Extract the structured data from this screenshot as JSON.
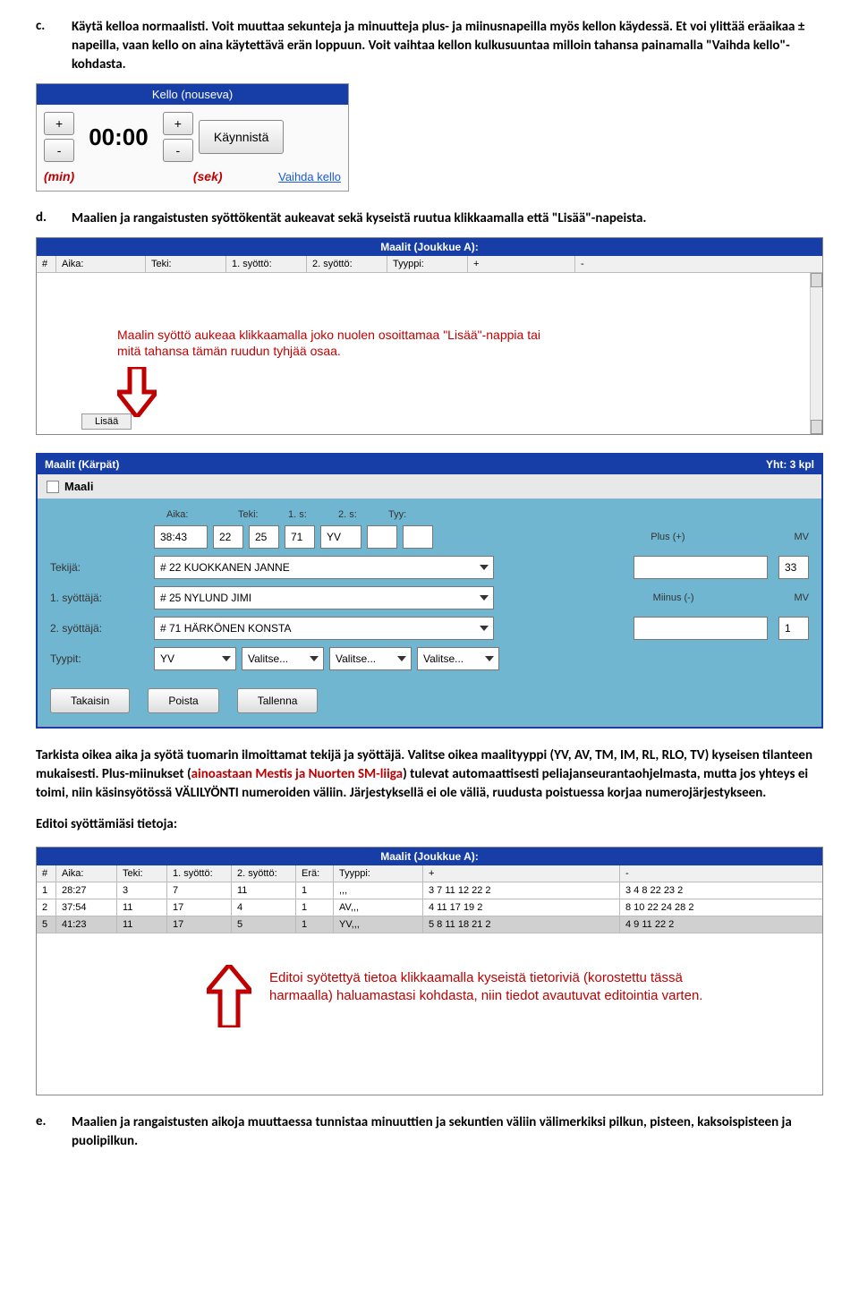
{
  "item_c": {
    "marker": "c.",
    "text_bold": "Käytä kelloa normaalisti. Voit muuttaa sekunteja ja minuutteja plus- ja miinusnapeilla myös kellon käydessä. Et voi ylittää eräaikaa ± napeilla, vaan kello on aina käytettävä erän loppuun. Voit vaihtaa kellon kulkusuuntaa milloin tahansa painamalla \"Vaihda kello\"-kohdasta."
  },
  "kello": {
    "title": "Kello (nouseva)",
    "plus": "+",
    "minus": "-",
    "time": "00:00",
    "kaynnista": "Käynnistä",
    "min": "(min)",
    "sek": "(sek)",
    "vaihda": "Vaihda kello"
  },
  "item_d": {
    "marker": "d.",
    "text_prefix_bold": "Maalien ja rangaistusten ",
    "text_rest_bold": "syöttökentät aukeavat sekä kyseistä ruutua klikkaamalla että \"Lisää\"-napeista."
  },
  "maalit_a": {
    "title": "Maalit (Joukkue A):",
    "cols": [
      "#",
      "Aika:",
      "Teki:",
      "1. syöttö:",
      "2. syöttö:",
      "Tyyppi:",
      "+",
      "-"
    ],
    "hint1": "Maalin syöttö aukeaa klikkaamalla joko nuolen osoittamaa \"Lisää\"-nappia tai",
    "hint2": "mitä tahansa tämän ruudun tyhjää osaa.",
    "lisaa": "Lisää"
  },
  "maali_editor": {
    "bar_left": "Maalit (Kärpät)",
    "bar_right": "Yht: 3 kpl",
    "win_title": "Maali",
    "head": {
      "aika": "Aika:",
      "teki": "Teki:",
      "s1": "1. s:",
      "s2": "2. s:",
      "tyy": "Tyy:"
    },
    "row1": {
      "aika": "38:43",
      "teki": "22",
      "s1": "25",
      "s2": "71",
      "tyy": "YV"
    },
    "plus_label": "Plus (+)",
    "mv_label": "MV",
    "tekija_label": "Tekijä:",
    "tekija_value": "# 22 KUOKKANEN JANNE",
    "mv1": "33",
    "s1_label": "1. syöttäjä:",
    "s1_value": "# 25 NYLUND JIMI",
    "minus_label": "Miinus (-)",
    "s2_label": "2. syöttäjä:",
    "s2_value": "# 71 HÄRKÖNEN KONSTA",
    "mv2": "1",
    "tyypit_label": "Tyypit:",
    "tyy_sel": "YV",
    "valitse": "Valitse...",
    "takaisin": "Takaisin",
    "poista": "Poista",
    "tallenna": "Tallenna"
  },
  "para1": {
    "t1": "Tarkista oikea aika ja syötä tuomarin ilmoittamat tekijä ja syöttäjä. Valitse oikea maalityyppi (YV, AV, TM, IM, RL, RLO, TV) kyseisen tilanteen mukaisesti. Plus-miinukset (",
    "accent": "ainoastaan Mestis ja Nuorten SM-liiga",
    "t2": ") tulevat automaattisesti peliajanseurantaohjelmasta, mutta jos yhteys ei toimi, niin käsinsyötössä VÄLILYÖNTI numeroiden väliin. Järjestyksellä ei ole väliä, ruudusta poistuessa korjaa numerojärjestykseen."
  },
  "editoi_heading": "Editoi syöttämiäsi tietoja:",
  "goals_table": {
    "title": "Maalit (Joukkue A):",
    "head": [
      "#",
      "Aika:",
      "Teki:",
      "1. syöttö:",
      "2. syöttö:",
      "Erä:",
      "Tyyppi:",
      "+",
      "-"
    ],
    "rows": [
      [
        "1",
        "28:27",
        "3",
        "7",
        "11",
        "1",
        ",,,",
        "3 7 11 12 22 2",
        "3 4 8 22 23 2"
      ],
      [
        "2",
        "37:54",
        "11",
        "17",
        "4",
        "1",
        "AV,,,",
        "4 11 17 19 2",
        "8 10 22 24 28 2"
      ],
      [
        "5",
        "41:23",
        "11",
        "17",
        "5",
        "1",
        "YV,,,",
        "5 8 11 18 21 2",
        "4 9 11 22 2"
      ]
    ],
    "hint": "Editoi syötettyä tietoa klikkaamalla kyseistä tietoriviä (korostettu tässä harmaalla) haluamastasi kohdasta, niin tiedot avautuvat editointia varten."
  },
  "item_e": {
    "marker": "e.",
    "text": "Maalien ja rangaistusten aikoja muuttaessa tunnistaa minuuttien ja sekuntien väliin välimerkiksi pilkun, pisteen, kaksoispisteen ja puolipilkun."
  }
}
